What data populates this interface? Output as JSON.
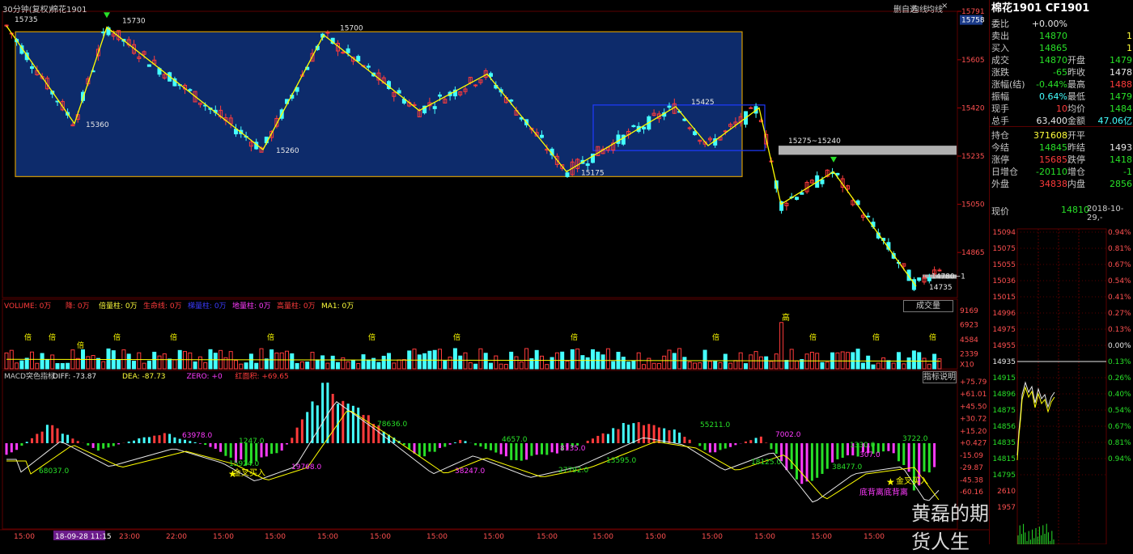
{
  "window": {
    "period_label": "30分钟(复权)",
    "instrument": "棉花1901",
    "toolbar": [
      "删自选",
      "均线",
      "均线"
    ],
    "toolbar_icons": [
      "arrow-left-icon",
      "window-restore-icon",
      "close-icon"
    ]
  },
  "colors": {
    "up": "#ff3b3b",
    "down": "#4ff",
    "bg": "#000000",
    "box": "#0d2b6b",
    "zigzag": "#ffff00",
    "grid": "#5a0000"
  },
  "price_axis": [
    "15791",
    "15605",
    "15420",
    "15235",
    "15050",
    "14865"
  ],
  "price_axis_highlight": "15758",
  "annotations": [
    "15735",
    "15730",
    "15360",
    "15700",
    "15260",
    "15175",
    "15425",
    "15275~15240",
    "14780~1",
    "14735"
  ],
  "volume": {
    "header": [
      "VOLUME: 0万",
      "降: 0万",
      "倍量柱: 0万",
      "生命线: 0万",
      "梯量柱: 0万",
      "地量柱: 0万",
      "高量柱: 0万",
      "MA1: 0万"
    ],
    "header_colors": [
      "#ff3b3b",
      "#ff3b3b",
      "#ffff3b",
      "#ff3b3b",
      "#3b3bff",
      "#ff3bff",
      "#ff3b3b",
      "#ffff3b"
    ],
    "axis": [
      "9169",
      "6923",
      "4584",
      "2339",
      "X10"
    ],
    "mark_bei": "倍",
    "mark_gao": "高",
    "dropdown": "成交量"
  },
  "macd": {
    "header": [
      "MACD突色指标",
      "DIFF: -73.87",
      "DEA: -87.73",
      "ZERO: +0",
      "红面积: +69.65"
    ],
    "header_colors": [
      "#c8c8c8",
      "#e8e8e8",
      "#ffff3b",
      "#ff3bff",
      "#ff3b3b"
    ],
    "axis": [
      "+75.79",
      "+61.01",
      "+45.50",
      "+30.72",
      "+15.20",
      "+0.427",
      "-15.09",
      "-29.87",
      "-45.38",
      "-60.16"
    ],
    "button": "指标说明",
    "labels": [
      "68037.0",
      "63978.0",
      "15924.0",
      "1247.0",
      "19768.0",
      "78636.0",
      "13595.0",
      "38247.0",
      "4657.0",
      "27792.0",
      "8135.0",
      "55211.0",
      "18125.0",
      "7002.0",
      "38477.0",
      "1330.0",
      "307.0",
      "3722.0"
    ],
    "gold_cross": "金叉买入",
    "divergence": "底背离底背离"
  },
  "time_axis": {
    "labels": [
      "15:00",
      "18-09-28 11:15",
      "23:00",
      "22:00",
      "15:00",
      "15:00",
      "15:00",
      "15:00",
      "15:00",
      "15:00",
      "15:00",
      "15:00",
      "15:00",
      "15:00",
      "15:00",
      "15:00",
      "15:00"
    ]
  },
  "quote": {
    "title": "棉花1901 CF1901",
    "rows": [
      {
        "l": "委比",
        "v": "+0.00%",
        "vc": "white",
        "l2": "",
        "v2": "",
        "v2c": "white"
      },
      {
        "l": "卖出",
        "v": "14870",
        "vc": "green",
        "l2": "",
        "v2": "1",
        "v2c": "yellow"
      },
      {
        "l": "买入",
        "v": "14865",
        "vc": "green",
        "l2": "",
        "v2": "1",
        "v2c": "yellow"
      },
      {
        "l": "成交",
        "v": "14870",
        "vc": "green",
        "l2": "开盘",
        "v2": "1479",
        "v2c": "green"
      },
      {
        "l": "涨跌",
        "v": "-65",
        "vc": "green",
        "l2": "昨收",
        "v2": "1478",
        "v2c": "white"
      },
      {
        "l": "涨幅(结)",
        "v": "-0.44%",
        "vc": "green",
        "l2": "最高",
        "v2": "1488",
        "v2c": "red"
      },
      {
        "l": "振幅",
        "v": "0.64%",
        "vc": "cyan",
        "l2": "最低",
        "v2": "1479",
        "v2c": "green"
      },
      {
        "l": "现手",
        "v": "10",
        "vc": "red",
        "l2": "均价",
        "v2": "1484",
        "v2c": "green"
      },
      {
        "l": "总手",
        "v": "63,400",
        "vc": "white",
        "l2": "金额",
        "v2": "47.06亿",
        "v2c": "cyan"
      },
      {
        "l": "持仓",
        "v": "371608",
        "vc": "yellow",
        "l2": "开平",
        "v2": "",
        "v2c": "white"
      },
      {
        "l": "今结",
        "v": "14845",
        "vc": "green",
        "l2": "昨结",
        "v2": "1493",
        "v2c": "white"
      },
      {
        "l": "涨停",
        "v": "15685",
        "vc": "red",
        "l2": "跌停",
        "v2": "1418",
        "v2c": "green"
      },
      {
        "l": "日增仓",
        "v": "-20110",
        "vc": "green",
        "l2": "增仓",
        "v2": "-1",
        "v2c": "green"
      },
      {
        "l": "外盘",
        "v": "34838",
        "vc": "red",
        "l2": "内盘",
        "v2": "2856",
        "v2c": "green"
      }
    ],
    "now_label": "现价",
    "now_value": "14810",
    "datetime": "2018-10-29,-",
    "mini_left": [
      "15094",
      "15075",
      "15055",
      "15036",
      "15015",
      "14996",
      "14975",
      "14955",
      "14935",
      "14915",
      "14896",
      "14875",
      "14856",
      "14835",
      "14815",
      "14795",
      "2610",
      "1957"
    ],
    "mini_right": [
      "0.94%",
      "0.81%",
      "0.67%",
      "0.54%",
      "0.41%",
      "0.27%",
      "0.13%",
      "0.00%",
      "0.13%",
      "0.26%",
      "0.40%",
      "0.54%",
      "0.67%",
      "0.81%",
      "0.94%"
    ],
    "mini_center": "14935"
  },
  "watermark": "黄磊的期货人生"
}
